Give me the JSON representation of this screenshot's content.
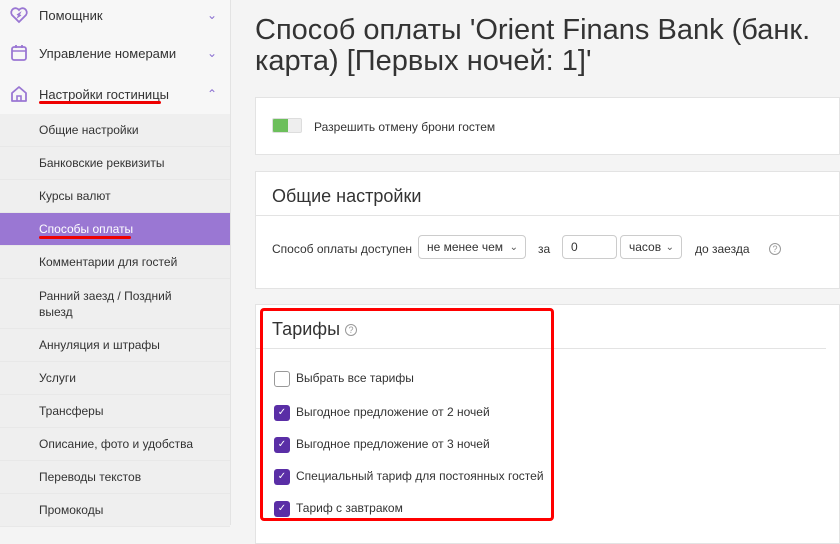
{
  "sidebar": {
    "top_items": [
      {
        "label": "Помощник"
      },
      {
        "label": "Управление номерами"
      },
      {
        "label": "Настройки гостиницы"
      }
    ],
    "sub_items": [
      "Общие настройки",
      "Банковские реквизиты",
      "Курсы валют",
      "Способы оплаты",
      "Комментарии для гостей",
      "Ранний заезд / Поздний выезд",
      "Аннуляция и штрафы",
      "Услуги",
      "Трансферы",
      "Описание, фото и удобства",
      "Переводы текстов",
      "Промокоды"
    ],
    "active": "Способы оплаты"
  },
  "main": {
    "title": "Способ оплаты 'Orient Finans Bank (банк. карта) [Первых ночей: 1]'",
    "toggle_label": "Разрешить отмену брони гостем",
    "toggle_on": true,
    "general": {
      "title": "Общие настройки",
      "label": "Способ оплаты доступен",
      "condition": "не менее чем",
      "za": "за",
      "value": "0",
      "unit": "часов",
      "suffix": "до заезда"
    },
    "tariffs": {
      "title": "Тарифы",
      "select_all": "Выбрать все тарифы",
      "items": [
        {
          "label": "Выгодное предложение от 2 ночей",
          "checked": true
        },
        {
          "label": "Выгодное предложение от 3 ночей",
          "checked": true
        },
        {
          "label": "Специальный тариф для постоянных гостей",
          "checked": true
        },
        {
          "label": "Тариф с завтраком",
          "checked": true
        }
      ]
    }
  },
  "colors": {
    "accent": "#9a77d3",
    "checkbox": "#5a2ea6",
    "toggle": "#6cbf5b",
    "highlight": "#ff0000"
  }
}
